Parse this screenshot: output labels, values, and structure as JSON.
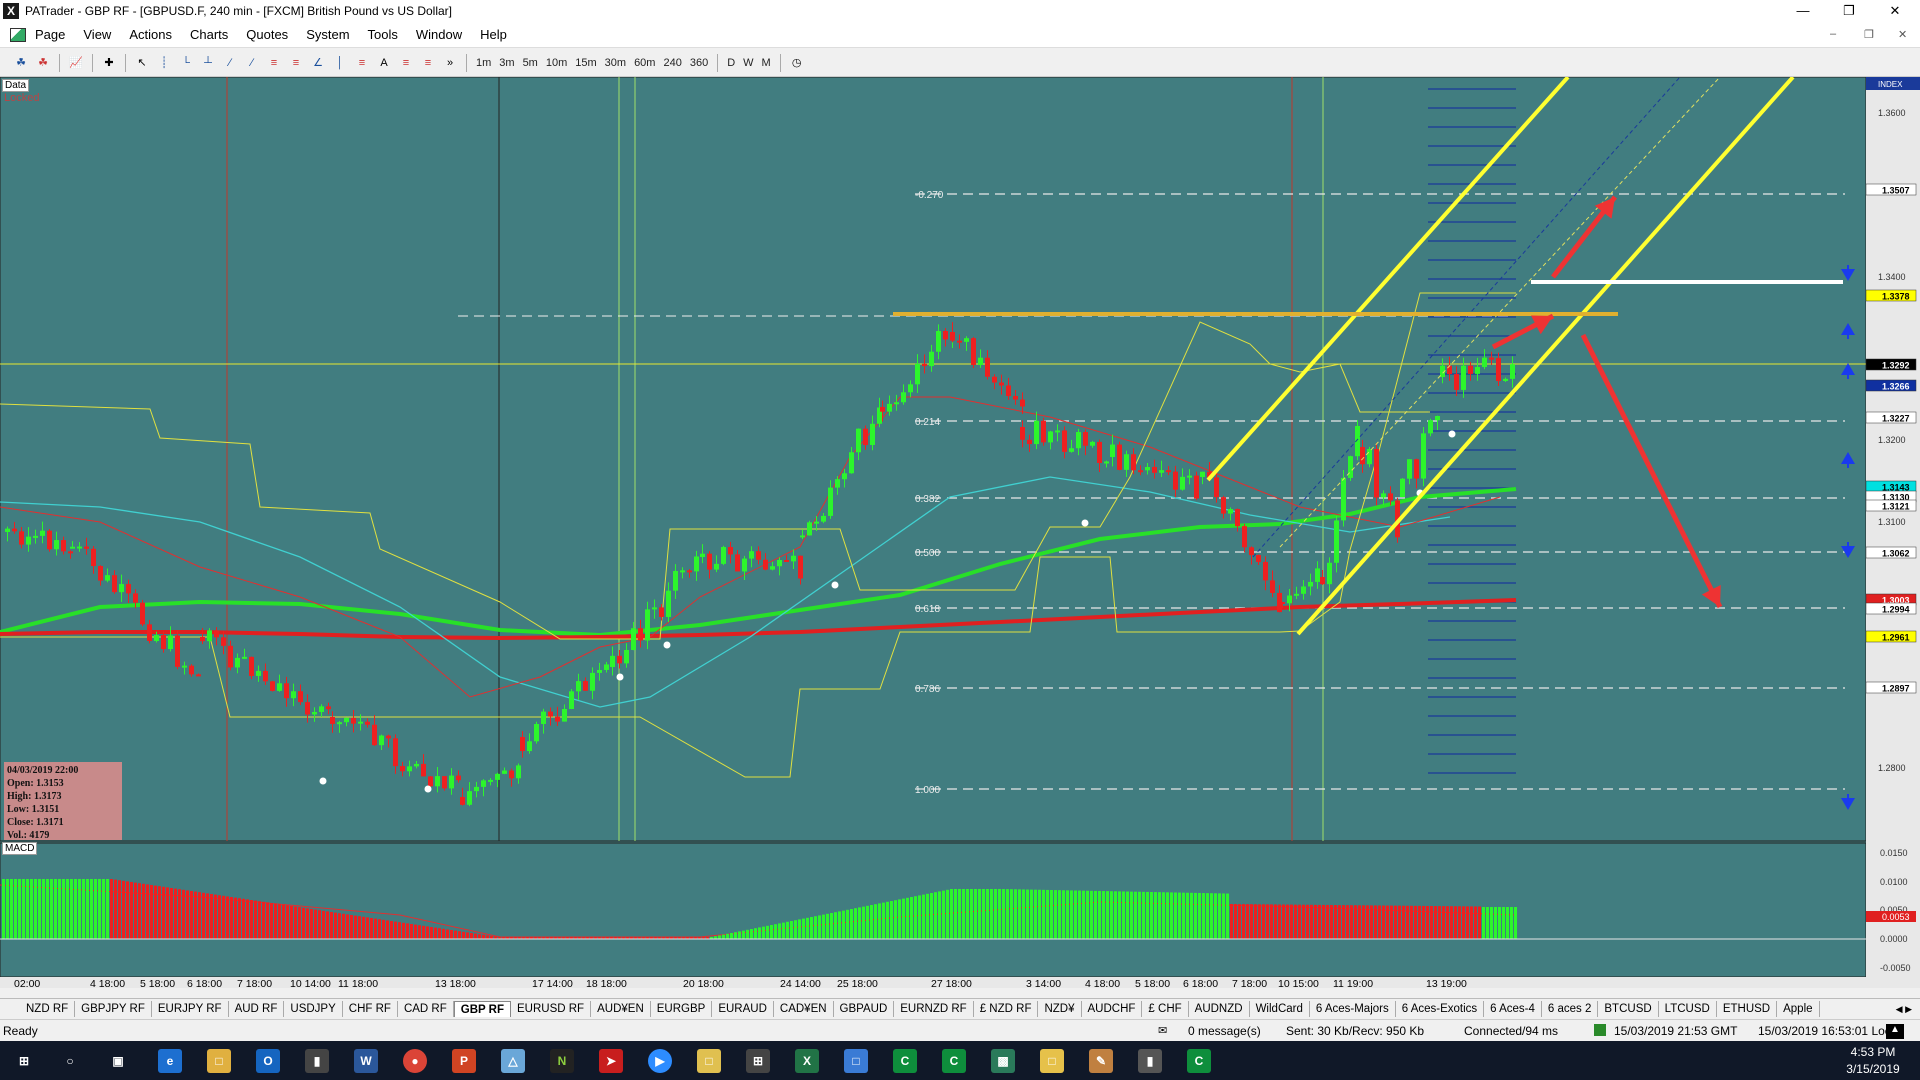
{
  "window": {
    "title": "PATrader - GBP RF - [GBPUSD.F, 240 min - [FXCM] British Pound vs US Dollar]",
    "app_icon": "X",
    "controls": [
      "minimize-icon",
      "restore-icon",
      "close-icon"
    ]
  },
  "menu": {
    "items": [
      "Page",
      "View",
      "Actions",
      "Charts",
      "Quotes",
      "System",
      "Tools",
      "Window",
      "Help"
    ]
  },
  "toolbar": {
    "timeframes": [
      "1m",
      "3m",
      "5m",
      "10m",
      "15m",
      "30m",
      "60m",
      "240",
      "360"
    ],
    "periods": [
      "D",
      "W",
      "M"
    ]
  },
  "chart": {
    "data_label": "Data",
    "locked_label": "Locked",
    "macd_label": "MACD",
    "infobox": {
      "date": "04/03/2019 22:00",
      "open": "Open: 1.3153",
      "high": "High: 1.3173",
      "low": "Low: 1.3151",
      "close": "Close: 1.3171",
      "vol": "Vol.: 4179"
    },
    "price_axis_header": "INDEX",
    "price_ticks": [
      "1.3600",
      "1.3400",
      "1.3200",
      "1.3100",
      "1.2800"
    ],
    "price_labels": [
      {
        "text": "1.3507",
        "bg": "#ffffff",
        "fg": "#000000"
      },
      {
        "text": "1.3378",
        "bg": "#ffff00",
        "fg": "#000000"
      },
      {
        "text": "1.3292",
        "bg": "#000000",
        "fg": "#ffffff"
      },
      {
        "text": "1.3266",
        "bg": "#1030a0",
        "fg": "#ffffff"
      },
      {
        "text": "1.3227",
        "bg": "#ffffff",
        "fg": "#000000"
      },
      {
        "text": "1.3143",
        "bg": "#00e0e0",
        "fg": "#000000"
      },
      {
        "text": "1.3130",
        "bg": "#ffffff",
        "fg": "#000000"
      },
      {
        "text": "1.3121",
        "bg": "#ffffff",
        "fg": "#000000"
      },
      {
        "text": "1.3062",
        "bg": "#ffffff",
        "fg": "#000000"
      },
      {
        "text": "1.3003",
        "bg": "#e02020",
        "fg": "#ffffff"
      },
      {
        "text": "1.2994",
        "bg": "#ffffff",
        "fg": "#000000"
      },
      {
        "text": "1.2961",
        "bg": "#ffff00",
        "fg": "#000000"
      },
      {
        "text": "1.2897",
        "bg": "#ffffff",
        "fg": "#000000"
      }
    ],
    "fib_levels": [
      "-0.270",
      "0.214",
      "0.382",
      "0.500",
      "0.618",
      "0.786",
      "1.000"
    ],
    "macd_ticks": [
      "0.0150",
      "0.0100",
      "0.0050",
      "0.0000",
      "-0.0050"
    ],
    "macd_value": "0.0053",
    "time_labels": [
      "02:00",
      "4 18:00",
      "5 18:00",
      "6 18:00",
      "7 18:00",
      "10 14:00",
      "11 18:00",
      "13 18:00",
      "17 14:00",
      "18 18:00",
      "20 18:00",
      "24 14:00",
      "25 18:00",
      "27 18:00",
      "3 14:00",
      "4 18:00",
      "5 18:00",
      "6 18:00",
      "7 18:00",
      "10 15:00",
      "11 19:00",
      "13 19:00"
    ]
  },
  "tabs": {
    "items": [
      "NZD RF",
      "GBPJPY RF",
      "EURJPY RF",
      "AUD RF",
      "USDJPY",
      "CHF RF",
      "CAD RF",
      "GBP RF",
      "EURUSD RF",
      "AUD¥EN",
      "EURGBP",
      "EURAUD",
      "CAD¥EN",
      "GBPAUD",
      "EURNZD RF",
      "£ NZD RF",
      "NZD¥",
      "AUDCHF",
      "£ CHF",
      "AUDNZD",
      "WildCard",
      "6 Aces-Majors",
      "6 Aces-Exotics",
      "6 Aces-4",
      "6 aces 2",
      "BTCUSD",
      "LTCUSD",
      "ETHUSD",
      "Apple"
    ],
    "active": "GBP RF"
  },
  "status": {
    "ready": "Ready",
    "messages": "0 message(s)",
    "traffic": "Sent: 30 Kb/Recv: 950 Kb",
    "connection": "Connected/94 ms",
    "gmt_time": "15/03/2019 21:53 GMT",
    "local_time": "15/03/2019 16:53:01 Local"
  },
  "taskbar": {
    "clock_time": "4:53 PM",
    "clock_date": "3/15/2019"
  }
}
